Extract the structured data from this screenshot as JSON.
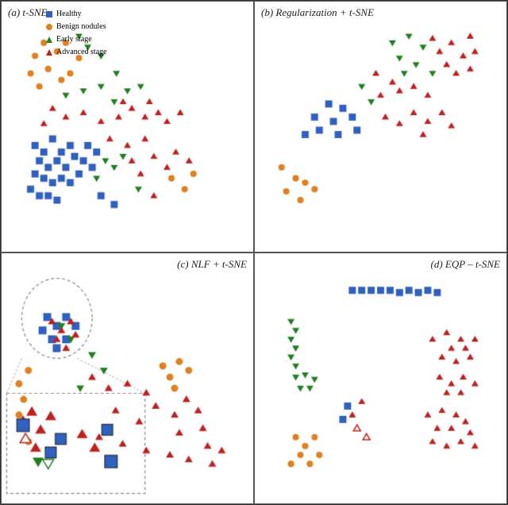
{
  "panels": [
    {
      "id": "a",
      "title": "(a) t-SNE",
      "position": "top-left"
    },
    {
      "id": "b",
      "title": "(b) Regularization + t-SNE",
      "position": "top-right"
    },
    {
      "id": "c",
      "title": "(c) NLF + t-SNE",
      "position": "bottom-left"
    },
    {
      "id": "d",
      "title": "(d) EQP – t-SNE",
      "position": "bottom-right"
    }
  ],
  "legend": {
    "items": [
      {
        "label": "Healthy",
        "color": "#3060c0",
        "shape": "square"
      },
      {
        "label": "Benign nodules",
        "color": "#e08020",
        "shape": "circle"
      },
      {
        "label": "Early stage",
        "color": "#208020",
        "shape": "triangle-down"
      },
      {
        "label": "Advanced stage",
        "color": "#c02020",
        "shape": "triangle-up"
      }
    ]
  },
  "colors": {
    "healthy": "#3060c0",
    "benign": "#e08020",
    "early": "#208020",
    "advanced": "#c02020",
    "border": "#555555",
    "background": "#ffffff"
  }
}
